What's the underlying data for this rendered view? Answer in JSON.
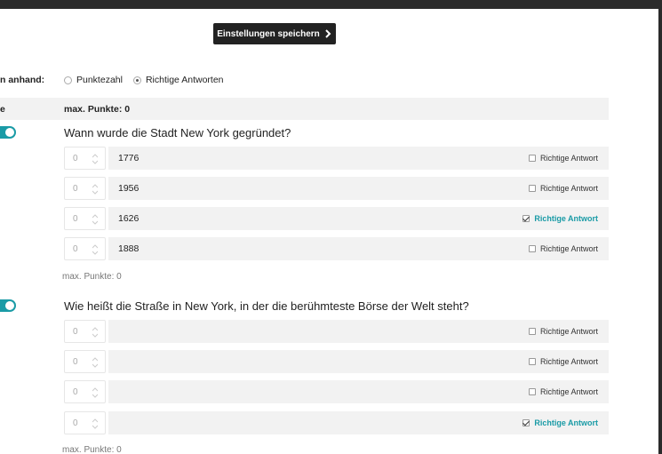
{
  "toolbar": {
    "save_label": "Einstellungen speichern",
    "save_icon": "chevron-right-icon"
  },
  "evaluation": {
    "label": "n anhand:",
    "options": [
      {
        "label": "Punktezahl",
        "checked": false
      },
      {
        "label": "Richtige Antworten",
        "checked": true
      }
    ]
  },
  "header": {
    "left_label": "e",
    "max_points_label": "max. Punkte: 0"
  },
  "questions": [
    {
      "title": "Wann wurde die Stadt New York gegründet?",
      "answers": [
        {
          "points_placeholder": "0",
          "text": "1776",
          "correct_label": "Richtige Antwort",
          "correct": false
        },
        {
          "points_placeholder": "0",
          "text": "1956",
          "correct_label": "Richtige Antwort",
          "correct": false
        },
        {
          "points_placeholder": "0",
          "text": "1626",
          "correct_label": "Richtige Antwort",
          "correct": true
        },
        {
          "points_placeholder": "0",
          "text": "1888",
          "correct_label": "Richtige Antwort",
          "correct": false
        }
      ],
      "max_points": "max. Punkte: 0"
    },
    {
      "title": "Wie heißt die Straße in New York, in der die berühmteste Börse der Welt steht?",
      "answers": [
        {
          "points_placeholder": "0",
          "text": "",
          "correct_label": "Richtige Antwort",
          "correct": false
        },
        {
          "points_placeholder": "0",
          "text": "",
          "correct_label": "Richtige Antwort",
          "correct": false
        },
        {
          "points_placeholder": "0",
          "text": "",
          "correct_label": "Richtige Antwort",
          "correct": false
        },
        {
          "points_placeholder": "0",
          "text": "",
          "correct_label": "Richtige Antwort",
          "correct": true
        }
      ],
      "max_points": "max. Punkte: 0"
    }
  ],
  "colors": {
    "accent": "#1a9ba6",
    "button_bg": "#222222",
    "row_bg": "#f2f2f2"
  }
}
